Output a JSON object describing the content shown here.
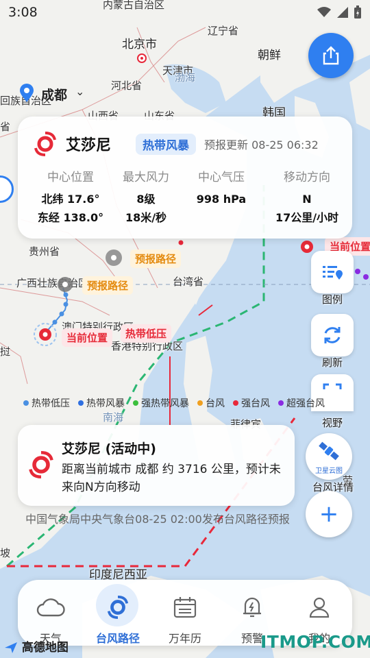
{
  "status_bar": {
    "time": "3:08"
  },
  "map": {
    "labels": {
      "inner_mongolia": "内蒙古自治区",
      "beijing": "北京市",
      "liaoning": "辽宁省",
      "tianjin": "天津市",
      "north_korea": "朝鲜",
      "bohai": "渤海",
      "hebei": "河北省",
      "hui_region": "回族自治区",
      "shanxi": "山西省",
      "shandong": "山东省",
      "korea": "韩国",
      "guizhou": "贵州省",
      "guangxi": "广西壮族自治区",
      "taiwan": "台湾省",
      "macau": "澳门特别行政区",
      "hongkong": "香港特别行政区",
      "nanhai": "南海",
      "philippines": "菲律宾",
      "indonesia": "印度尼西亚",
      "left_edge_1": "省",
      "left_edge_2": "挝",
      "left_edge_3": "坡",
      "right_edge": "劳"
    }
  },
  "city": {
    "name": "成都"
  },
  "typhoon": {
    "name": "艾莎尼",
    "category": "热带风暴",
    "updated": "预报更新 08-25 06:32",
    "fields": [
      {
        "label": "中心位置",
        "values": [
          "北纬 17.6°",
          "东经 138.0°"
        ]
      },
      {
        "label": "最大风力",
        "values": [
          "8级",
          "18米/秒"
        ]
      },
      {
        "label": "中心气压",
        "values": [
          "998 hPa",
          ""
        ]
      },
      {
        "label": "移动方向",
        "values": [
          "N",
          "17公里/小时"
        ]
      }
    ]
  },
  "tags": {
    "forecast_1": "预报路径",
    "forecast_2": "预报路径",
    "current_1": "当前位置",
    "current_2": "当前位置",
    "depression": "热带低压"
  },
  "tools": {
    "legend": "图例",
    "refresh": "刷新",
    "view": "视野",
    "satellite_badge": "卫星云图",
    "detail": "台风详情"
  },
  "legend": [
    {
      "label": "热带低压",
      "color": "#4a90e2"
    },
    {
      "label": "热带风暴",
      "color": "#2f6fe0"
    },
    {
      "label": "强热带风暴",
      "color": "#3cbf3c"
    },
    {
      "label": "台风",
      "color": "#f0a020"
    },
    {
      "label": "强台风",
      "color": "#e8283a"
    },
    {
      "label": "超强台风",
      "color": "#8a2be2"
    }
  ],
  "status_card": {
    "title": "艾莎尼 (活动中)",
    "desc": "距离当前城市 成都 约 3716 公里，预计未来向N方向移动"
  },
  "source": "中国气象局中央气象台08-25 02:00发布台风路径预报",
  "zoom_label": "+",
  "nav": [
    {
      "label": "天气",
      "icon": "cloud-icon"
    },
    {
      "label": "台风路径",
      "icon": "typhoon-icon"
    },
    {
      "label": "万年历",
      "icon": "calendar-icon"
    },
    {
      "label": "预警",
      "icon": "bell-icon"
    },
    {
      "label": "我的",
      "icon": "user-icon"
    }
  ],
  "logo": "高德地图",
  "watermark": "ITMOP.COM",
  "colors": {
    "accent": "#2f7ff0",
    "danger": "#e62a38",
    "forecast": "#e48b10"
  }
}
